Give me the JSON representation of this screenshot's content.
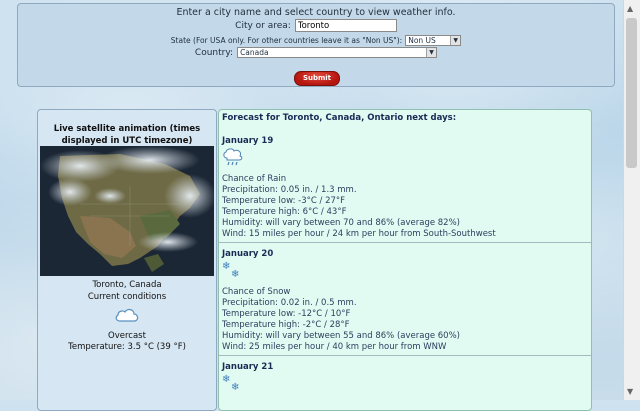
{
  "search": {
    "prompt": "Enter a city name and select country to view weather info.",
    "city_label": "City or area:",
    "city_value": "Toronto",
    "state_label": "State",
    "state_hint": "(For USA only. For other countries leave it as \"Non US\"):",
    "state_value": "Non US",
    "country_label": "Country:",
    "country_value": "Canada",
    "submit_label": "Submit"
  },
  "current": {
    "satellite_title": "Live satellite animation (times displayed in UTC timezone)",
    "city": "Toronto, Canada",
    "label": "Current conditions",
    "icon": "cloud-icon",
    "description": "Overcast",
    "temperature": "Temperature: 3.5 °C (39 °F)"
  },
  "forecast": {
    "title": "Forecast for Toronto, Canada, Ontario next days:",
    "days": [
      {
        "date": "January 19",
        "icon": "rain-icon",
        "summary": "Chance of Rain",
        "precipitation": "Precipitation: 0.05 in. / 1.3 mm.",
        "temp_low": "Temperature low: -3°C / 27°F",
        "temp_high": "Temperature high: 6°C / 43°F",
        "humidity": "Humidity: will vary between 70 and 86% (average 82%)",
        "wind": "Wind: 15 miles per hour / 24 km per hour from South-Southwest"
      },
      {
        "date": "January 20",
        "icon": "snow-icon",
        "summary": "Chance of Snow",
        "precipitation": "Precipitation: 0.02 in. / 0.5 mm.",
        "temp_low": "Temperature low: -12°C / 10°F",
        "temp_high": "Temperature high: -2°C / 28°F",
        "humidity": "Humidity: will vary between 55 and 86% (average 60%)",
        "wind": "Wind: 25 miles per hour / 40 km per hour from WNW"
      },
      {
        "date": "January 21",
        "icon": "snow-icon"
      }
    ]
  },
  "colors": {
    "submit": "#c0180f",
    "forecast_bg": "#e1fbf2",
    "current_bg": "#d6e6f3"
  }
}
